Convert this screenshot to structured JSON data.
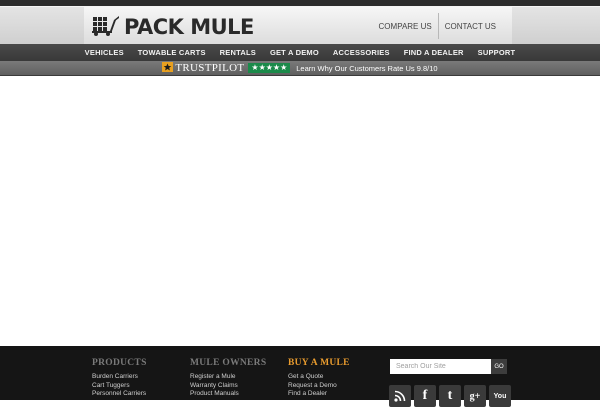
{
  "brand": {
    "name": "PACK MULE"
  },
  "header": {
    "links": [
      {
        "label": "COMPARE US"
      },
      {
        "label": "CONTACT US"
      }
    ]
  },
  "nav": {
    "items": [
      {
        "label": "VEHICLES"
      },
      {
        "label": "TOWABLE CARTS"
      },
      {
        "label": "RENTALS"
      },
      {
        "label": "GET A DEMO"
      },
      {
        "label": "ACCESSORIES"
      },
      {
        "label": "FIND A DEALER"
      },
      {
        "label": "SUPPORT"
      }
    ]
  },
  "trustbar": {
    "brand": "TRUSTPILOT",
    "stars": "★★★★★",
    "message": "Learn Why Our Customers Rate Us 9.8/10"
  },
  "footer": {
    "columns": [
      {
        "title": "PRODUCTS",
        "links": [
          "Burden Carriers",
          "Cart Tuggers",
          "Personnel Carriers"
        ]
      },
      {
        "title": "MULE OWNERS",
        "links": [
          "Register a Mule",
          "Warranty Claims",
          "Product Manuals"
        ]
      },
      {
        "title": "BUY A MULE",
        "links": [
          "Get a Quote",
          "Request a Demo",
          "Find a Dealer"
        ]
      }
    ],
    "search": {
      "placeholder": "Search Our Site",
      "button": "GO"
    },
    "social": [
      {
        "icon": "rss-icon",
        "glyph": ""
      },
      {
        "icon": "facebook-icon",
        "glyph": "f"
      },
      {
        "icon": "twitter-icon",
        "glyph": "t"
      },
      {
        "icon": "google-plus-icon",
        "glyph": "g+"
      },
      {
        "icon": "youtube-icon",
        "glyph": "You"
      }
    ]
  },
  "colors": {
    "nav_bg": "#3f3f3f",
    "trustpilot_green": "#1b8a4a",
    "footer_bg": "#151515",
    "footer_highlight": "#e89b2e"
  }
}
